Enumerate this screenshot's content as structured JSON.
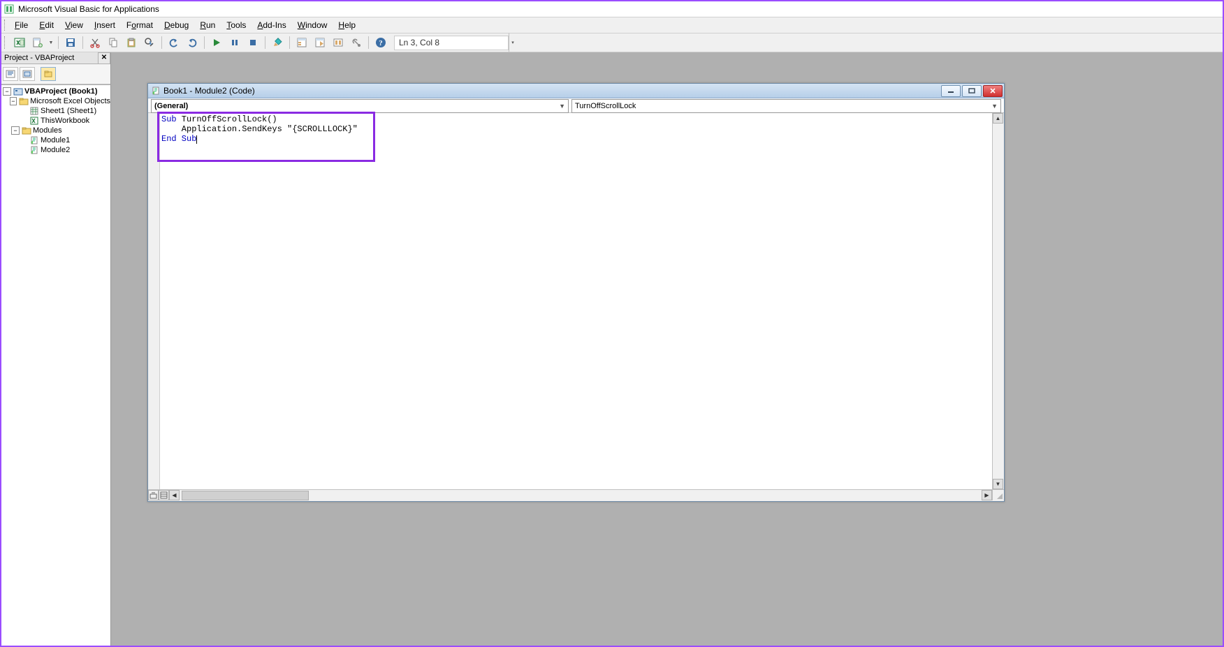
{
  "app": {
    "title": "Microsoft Visual Basic for Applications"
  },
  "menu": {
    "items": [
      "File",
      "Edit",
      "View",
      "Insert",
      "Format",
      "Debug",
      "Run",
      "Tools",
      "Add-Ins",
      "Window",
      "Help"
    ]
  },
  "toolbar": {
    "status": "Ln 3, Col 8"
  },
  "project_panel": {
    "title": "Project - VBAProject",
    "tree": {
      "root": "VBAProject (Book1)",
      "excel_objects_folder": "Microsoft Excel Objects",
      "sheet1": "Sheet1 (Sheet1)",
      "thisworkbook": "ThisWorkbook",
      "modules_folder": "Modules",
      "module1": "Module1",
      "module2": "Module2"
    }
  },
  "code_window": {
    "title": "Book1 - Module2 (Code)",
    "object_dropdown": "(General)",
    "proc_dropdown": "TurnOffScrollLock",
    "code": {
      "line1_kw": "Sub",
      "line1_rest": " TurnOffScrollLock()",
      "line2_indent": "    Application.SendKeys ",
      "line2_str": "\"{SCROLLLOCK}\"",
      "line3_kw": "End Sub"
    }
  }
}
